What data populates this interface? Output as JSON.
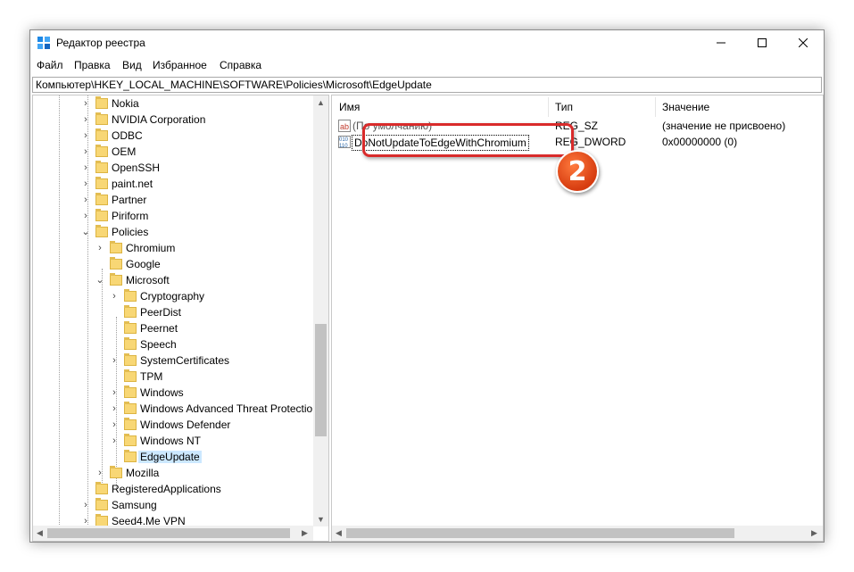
{
  "window": {
    "title": "Редактор реестра"
  },
  "menu": [
    "Файл",
    "Правка",
    "Вид",
    "Избранное",
    "Справка"
  ],
  "address": "Компьютер\\HKEY_LOCAL_MACHINE\\SOFTWARE\\Policies\\Microsoft\\EdgeUpdate",
  "tree": {
    "items": [
      {
        "label": "Nokia"
      },
      {
        "label": "NVIDIA Corporation"
      },
      {
        "label": "ODBC"
      },
      {
        "label": "OEM"
      },
      {
        "label": "OpenSSH"
      },
      {
        "label": "paint.net"
      },
      {
        "label": "Partner"
      },
      {
        "label": "Piriform"
      },
      {
        "label": "Policies"
      },
      {
        "label": "Chromium"
      },
      {
        "label": "Google"
      },
      {
        "label": "Microsoft"
      },
      {
        "label": "Cryptography"
      },
      {
        "label": "PeerDist"
      },
      {
        "label": "Peernet"
      },
      {
        "label": "Speech"
      },
      {
        "label": "SystemCertificates"
      },
      {
        "label": "TPM"
      },
      {
        "label": "Windows"
      },
      {
        "label": "Windows Advanced Threat Protection"
      },
      {
        "label": "Windows Defender"
      },
      {
        "label": "Windows NT"
      },
      {
        "label": "EdgeUpdate"
      },
      {
        "label": "Mozilla"
      },
      {
        "label": "RegisteredApplications"
      },
      {
        "label": "Samsung"
      },
      {
        "label": "Seed4.Me VPN"
      }
    ]
  },
  "list": {
    "headers": {
      "name": "Имя",
      "type": "Тип",
      "value": "Значение"
    },
    "rows": [
      {
        "name": "(По умолчанию)",
        "type": "REG_SZ",
        "value": "(значение не присвоено)"
      },
      {
        "name": "DoNotUpdateToEdgeWithChromium",
        "type": "REG_DWORD",
        "value": "0x00000000 (0)"
      }
    ]
  },
  "callout": {
    "number": "2"
  },
  "colors": {
    "highlight": "#d92b2b",
    "badge": "#d63c10",
    "selection": "#cce8ff",
    "folder": "#f8d775"
  }
}
